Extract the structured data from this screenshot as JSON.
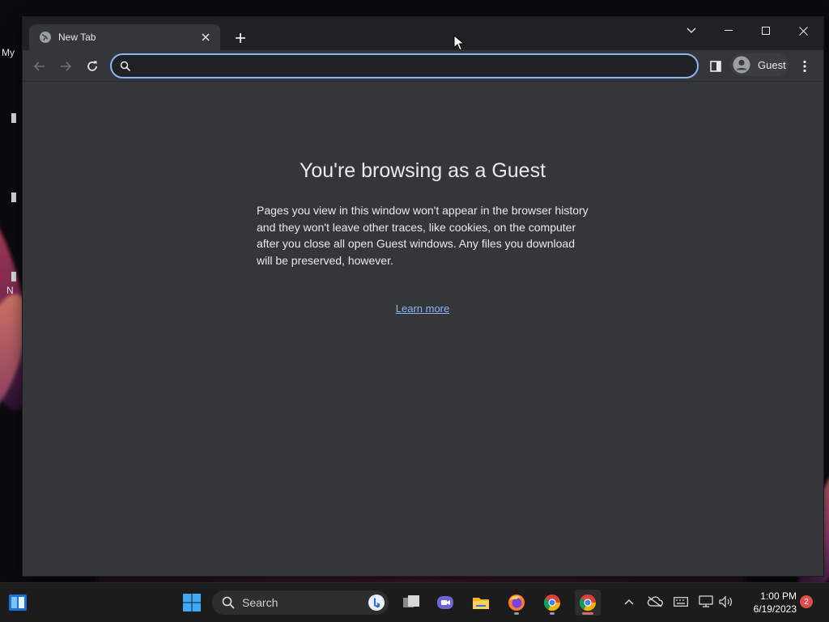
{
  "desktop": {
    "partial_labels": [
      "My",
      "N"
    ]
  },
  "browser": {
    "tab": {
      "title": "New Tab"
    },
    "omnibox": {
      "value": "",
      "placeholder": ""
    },
    "profile": {
      "label": "Guest"
    }
  },
  "page": {
    "heading": "You're browsing as a Guest",
    "body": "Pages you view in this window won't appear in the browser history and they won't leave other traces, like cookies, on the computer after you close all open Guest windows. Any files you download will be preserved, however.",
    "learn_more": "Learn more"
  },
  "taskbar": {
    "search_placeholder": "Search",
    "clock": {
      "time": "1:00 PM",
      "date": "6/19/2023"
    },
    "notification_count": "2"
  },
  "colors": {
    "accent": "#8ab4f8",
    "chrome_dark": "#202124",
    "page_bg": "#35363a",
    "badge": "#e04e4e"
  }
}
